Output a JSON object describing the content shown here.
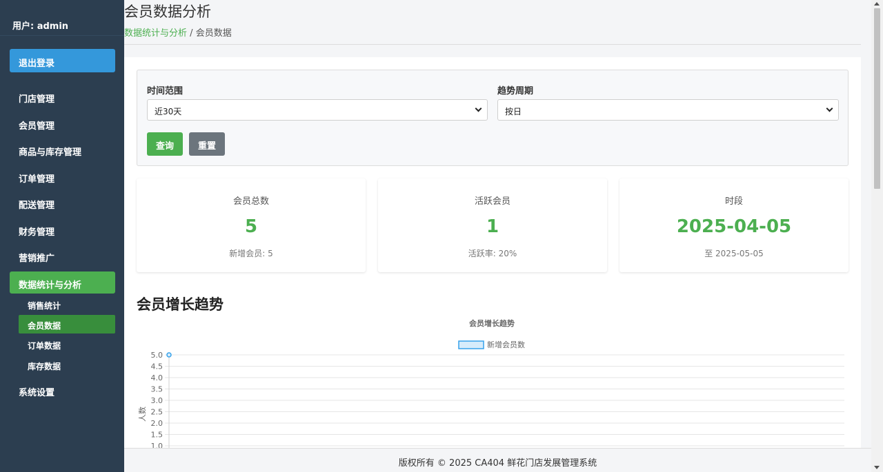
{
  "sidebar": {
    "user": "用户: admin",
    "logout": "退出登录",
    "items": [
      {
        "label": "门店管理"
      },
      {
        "label": "会员管理"
      },
      {
        "label": "商品与库存管理"
      },
      {
        "label": "订单管理"
      },
      {
        "label": "配送管理"
      },
      {
        "label": "财务管理"
      },
      {
        "label": "营销推广"
      },
      {
        "label": "数据统计与分析",
        "active": true
      },
      {
        "label": "系统设置"
      }
    ],
    "subitems": [
      {
        "label": "销售统计"
      },
      {
        "label": "会员数据",
        "active": true
      },
      {
        "label": "订单数据"
      },
      {
        "label": "库存数据"
      }
    ]
  },
  "header": {
    "title": "会员数据分析",
    "breadcrumb_link": "数据统计与分析",
    "breadcrumb_sep": "/",
    "breadcrumb_current": "会员数据"
  },
  "filters": {
    "range_label": "时间范围",
    "range_value": "近30天",
    "period_label": "趋势周期",
    "period_value": "按日",
    "query_button": "查询",
    "reset_button": "重置"
  },
  "cards": [
    {
      "label": "会员总数",
      "value": "5",
      "sub": "新增会员: 5"
    },
    {
      "label": "活跃会员",
      "value": "1",
      "sub": "活跃率: 20%"
    },
    {
      "label": "时段",
      "value": "2025-04-05",
      "sub": "至 2025-05-05"
    }
  ],
  "section_title": "会员增长趋势",
  "chart_data": {
    "type": "line",
    "title": "会员增长趋势",
    "ylabel": "人数",
    "ylim": [
      1.0,
      5.0
    ],
    "yticks": [
      "5.0",
      "4.5",
      "4.0",
      "3.5",
      "3.0",
      "2.5",
      "2.0",
      "1.5",
      "1.0"
    ],
    "legend_position": "top",
    "series": [
      {
        "name": "新增会员数",
        "values": [
          5
        ],
        "color": "#36a2eb"
      }
    ],
    "grid": true
  },
  "footer": "版权所有 © 2025 CA404 鲜花门店发展管理系统",
  "colors": {
    "accent": "#4caf50",
    "sidebar": "#2c3e50",
    "logout": "#3498db",
    "chart_line": "#36a2eb"
  }
}
